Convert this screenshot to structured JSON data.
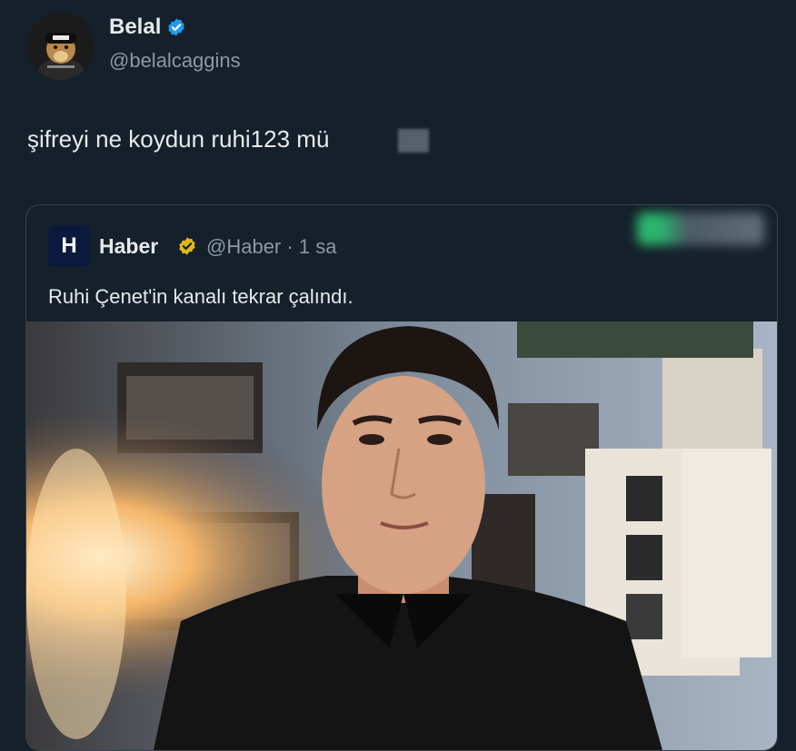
{
  "author": {
    "name": "Belal",
    "handle": "@belalcaggins",
    "verified": true
  },
  "tweet": {
    "text": "şifreyi ne koydun ruhi123 mü"
  },
  "quote": {
    "logo_letter": "H",
    "name": "Haber",
    "handle": "@Haber",
    "separator": "·",
    "time": "1 sa",
    "text": "Ruhi Çenet'in kanalı tekrar çalındı."
  },
  "colors": {
    "background": "#15202b",
    "verified_blue": "#1d9bf0",
    "verified_gold": "#e2b719",
    "text_primary": "#e7e9ea",
    "text_secondary": "#8b98a5"
  },
  "icons": {
    "verified": "verified-badge-icon",
    "gold_verified": "gold-verified-badge-icon"
  }
}
